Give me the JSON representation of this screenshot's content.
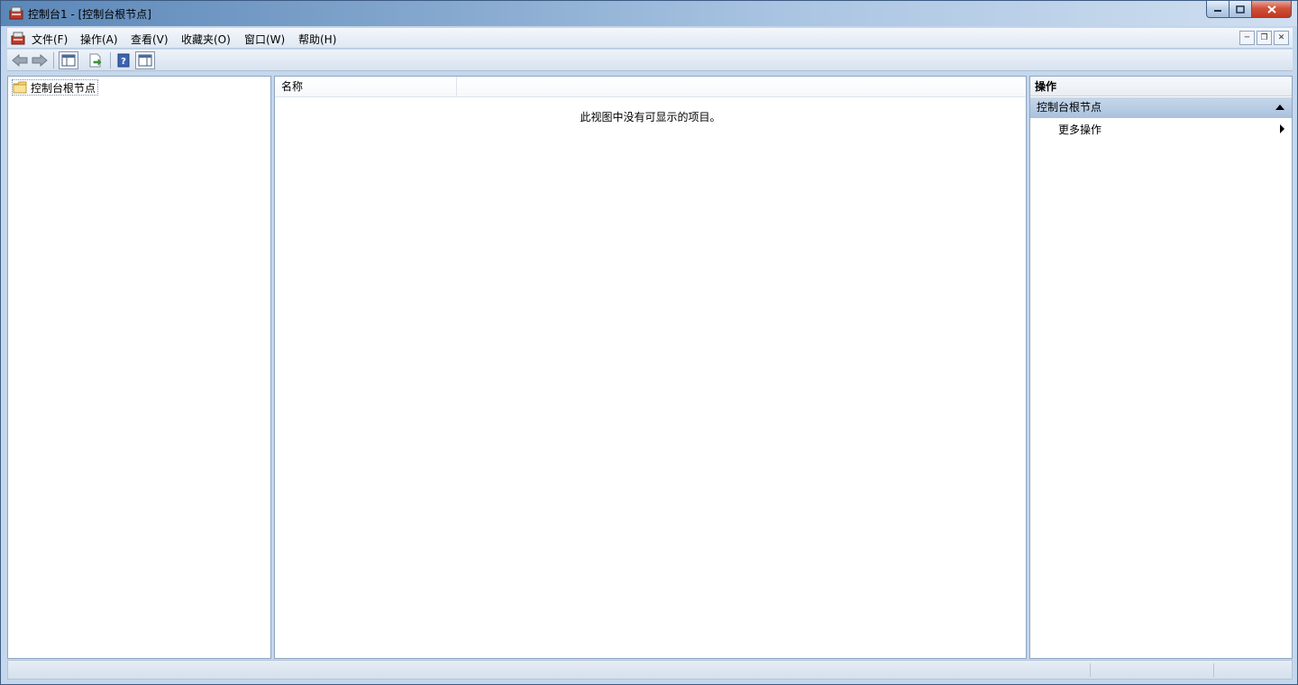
{
  "window": {
    "title": "控制台1 - [控制台根节点]",
    "icon": "mmc-console-icon"
  },
  "menubar": {
    "items": [
      {
        "label": "文件(F)"
      },
      {
        "label": "操作(A)"
      },
      {
        "label": "查看(V)"
      },
      {
        "label": "收藏夹(O)"
      },
      {
        "label": "窗口(W)"
      },
      {
        "label": "帮助(H)"
      }
    ]
  },
  "toolbar": {
    "buttons": [
      "back-arrow-icon",
      "forward-arrow-icon",
      "show-hide-tree-icon",
      "export-list-icon",
      "help-icon",
      "show-hide-action-pane-icon"
    ]
  },
  "tree": {
    "root_label": "控制台根节点"
  },
  "list": {
    "column_name": "名称",
    "empty_message": "此视图中没有可显示的项目。"
  },
  "actions": {
    "header": "操作",
    "group_title": "控制台根节点",
    "more_actions": "更多操作"
  },
  "colors": {
    "selection_group": "#a9c1de",
    "frame": "#c4d7ec",
    "close_button": "#c0381f"
  }
}
